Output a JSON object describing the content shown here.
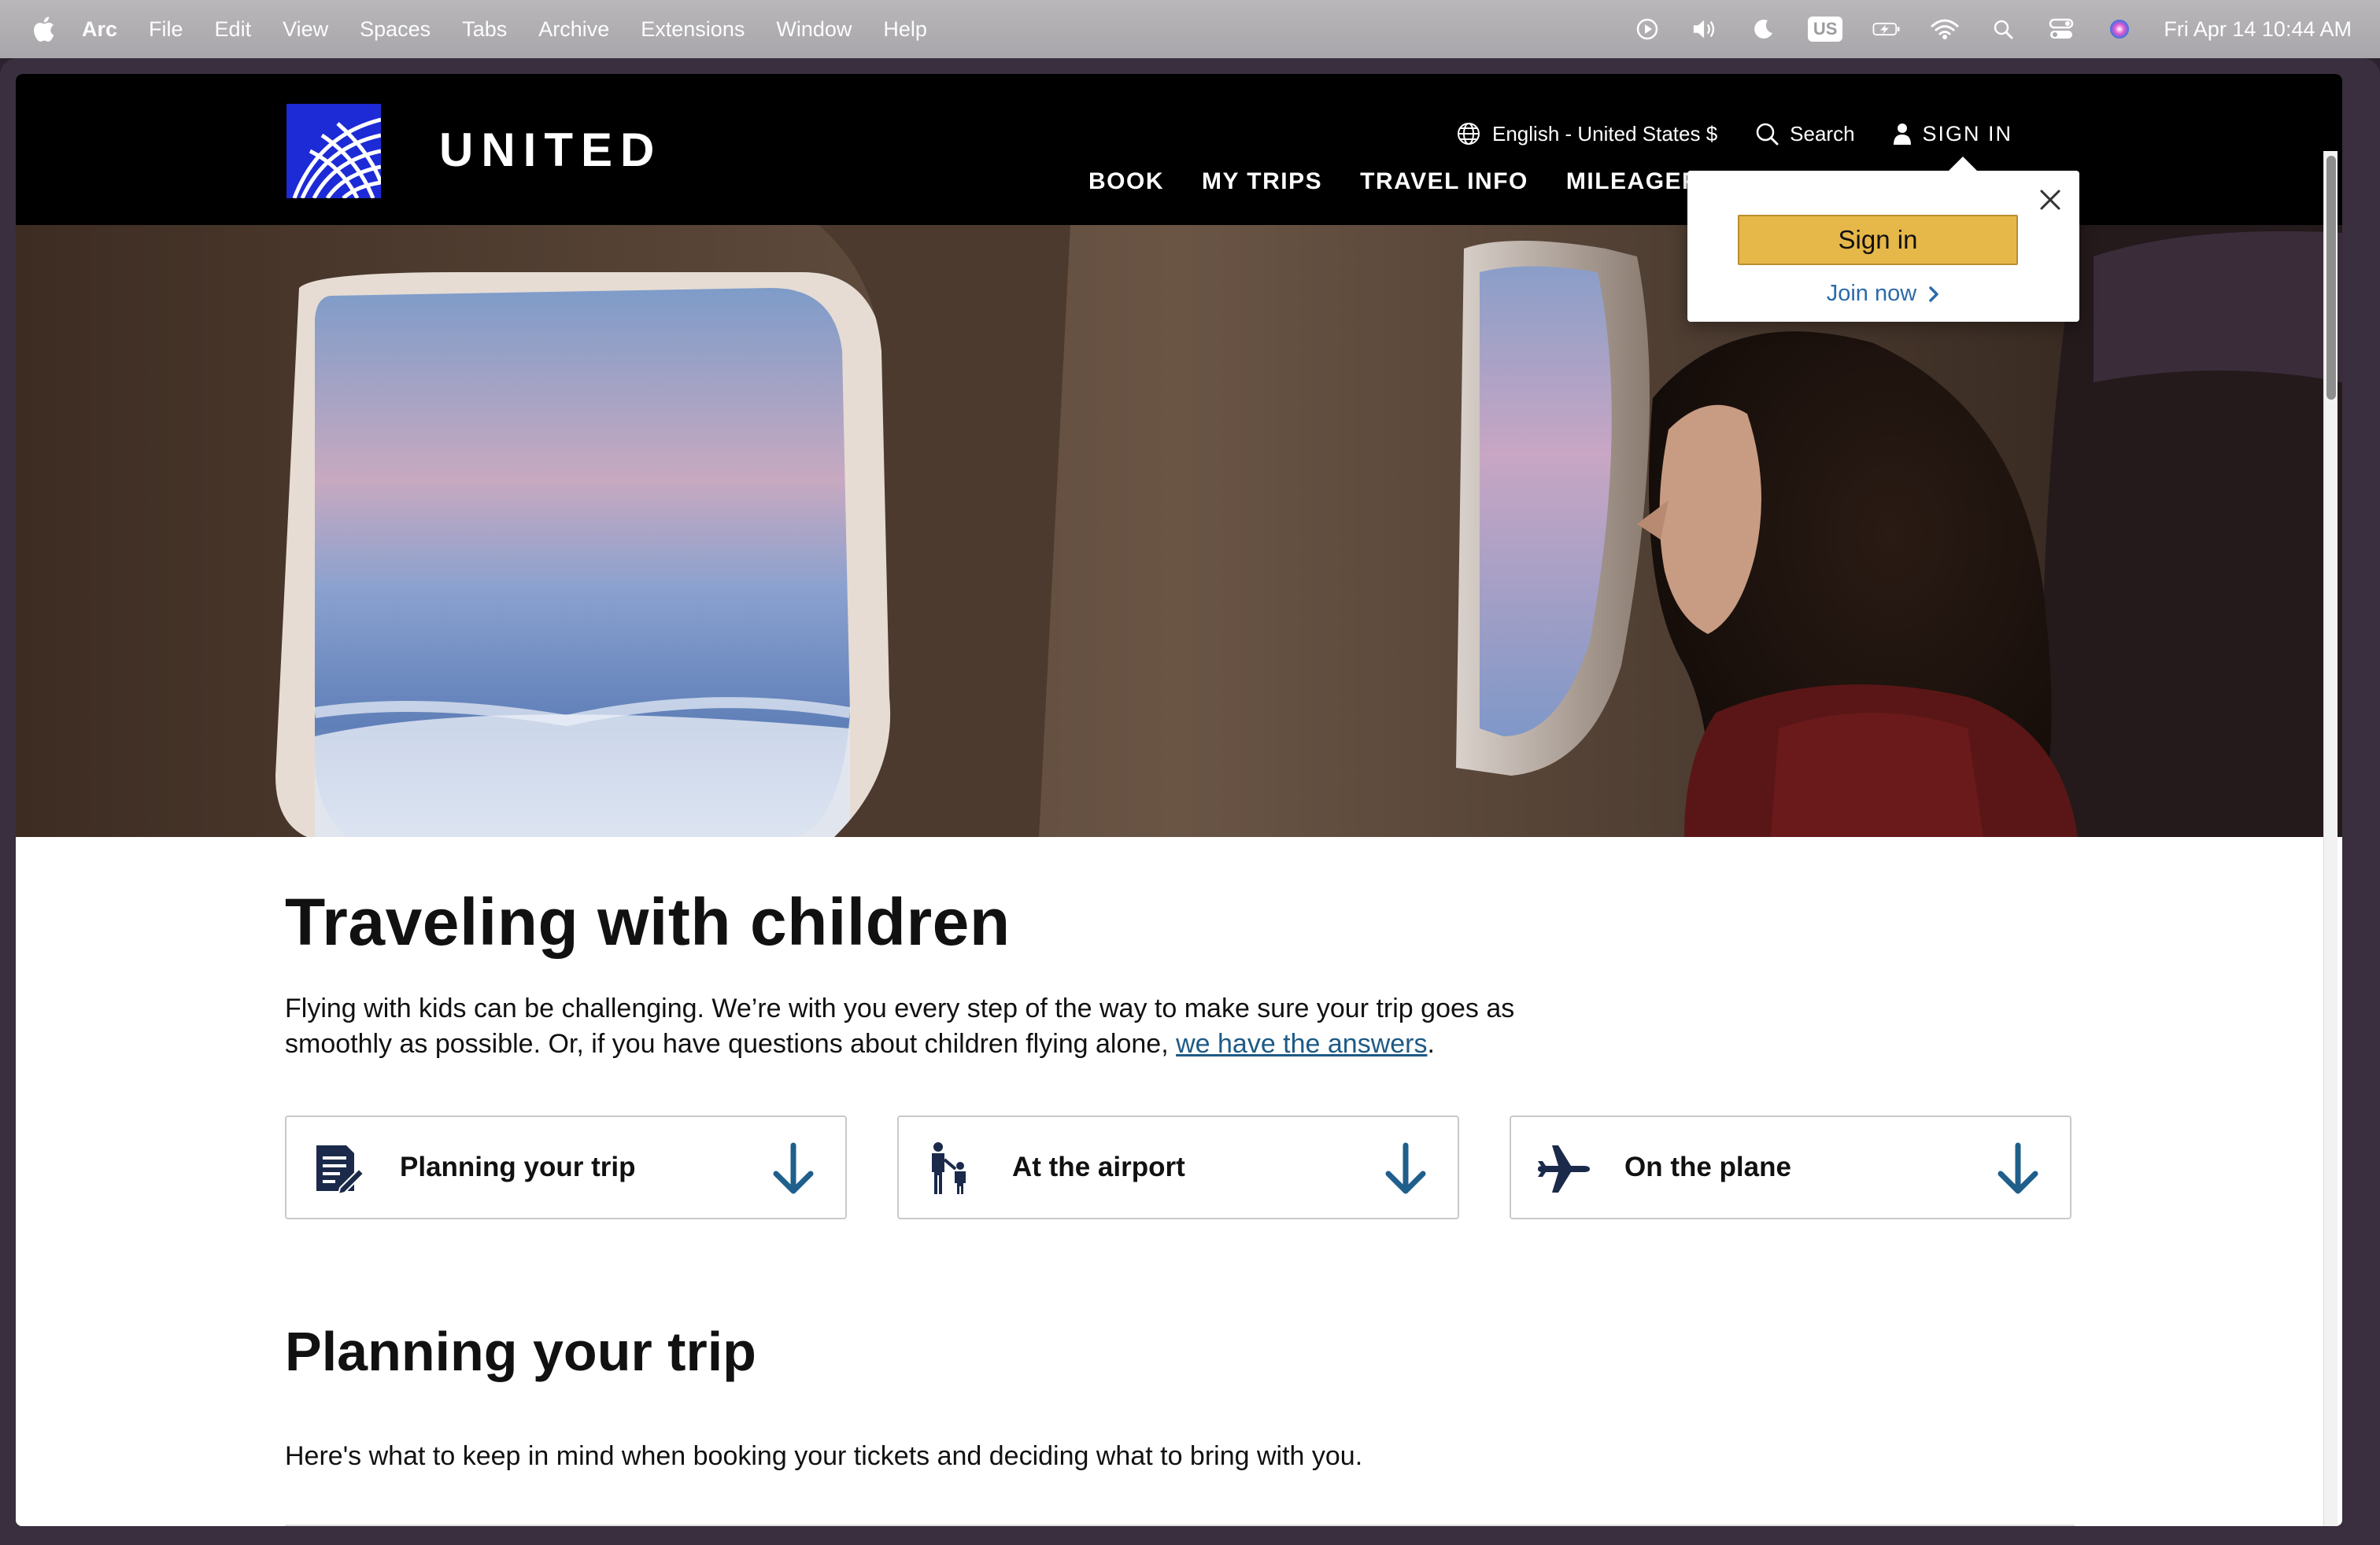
{
  "menubar": {
    "app_name": "Arc",
    "items": [
      "File",
      "Edit",
      "View",
      "Spaces",
      "Tabs",
      "Archive",
      "Extensions",
      "Window",
      "Help"
    ],
    "keyboard_badge": "US",
    "clock": "Fri Apr 14  10:44 AM"
  },
  "header": {
    "brand": "UNITED",
    "language": "English - United States $",
    "search_label": "Search",
    "signin_label": "SIGN IN",
    "nav": [
      "BOOK",
      "MY TRIPS",
      "TRAVEL INFO",
      "MILEAGEPLUS"
    ]
  },
  "popover": {
    "signin_button": "Sign in",
    "join_link": "Join now"
  },
  "page": {
    "title": "Traveling with children",
    "intro_text": "Flying with kids can be challenging. We’re with you every step of the way to make sure your trip goes as smoothly as possible. Or, if you have questions about children flying alone, ",
    "intro_link": "we have the answers",
    "intro_end": ".",
    "cards": [
      {
        "label": "Planning your trip",
        "icon": "checklist-icon"
      },
      {
        "label": "At the airport",
        "icon": "parent-child-icon"
      },
      {
        "label": "On the plane",
        "icon": "airplane-icon"
      }
    ],
    "section_title": "Planning your trip",
    "section_text": "Here's what to keep in mind when booking your tickets and deciding what to bring with you."
  },
  "colors": {
    "brand_blue": "#1d2bd6",
    "signin_button": "#e6b84a",
    "link_blue": "#1e5a86",
    "card_arrow": "#1f5f8b"
  }
}
